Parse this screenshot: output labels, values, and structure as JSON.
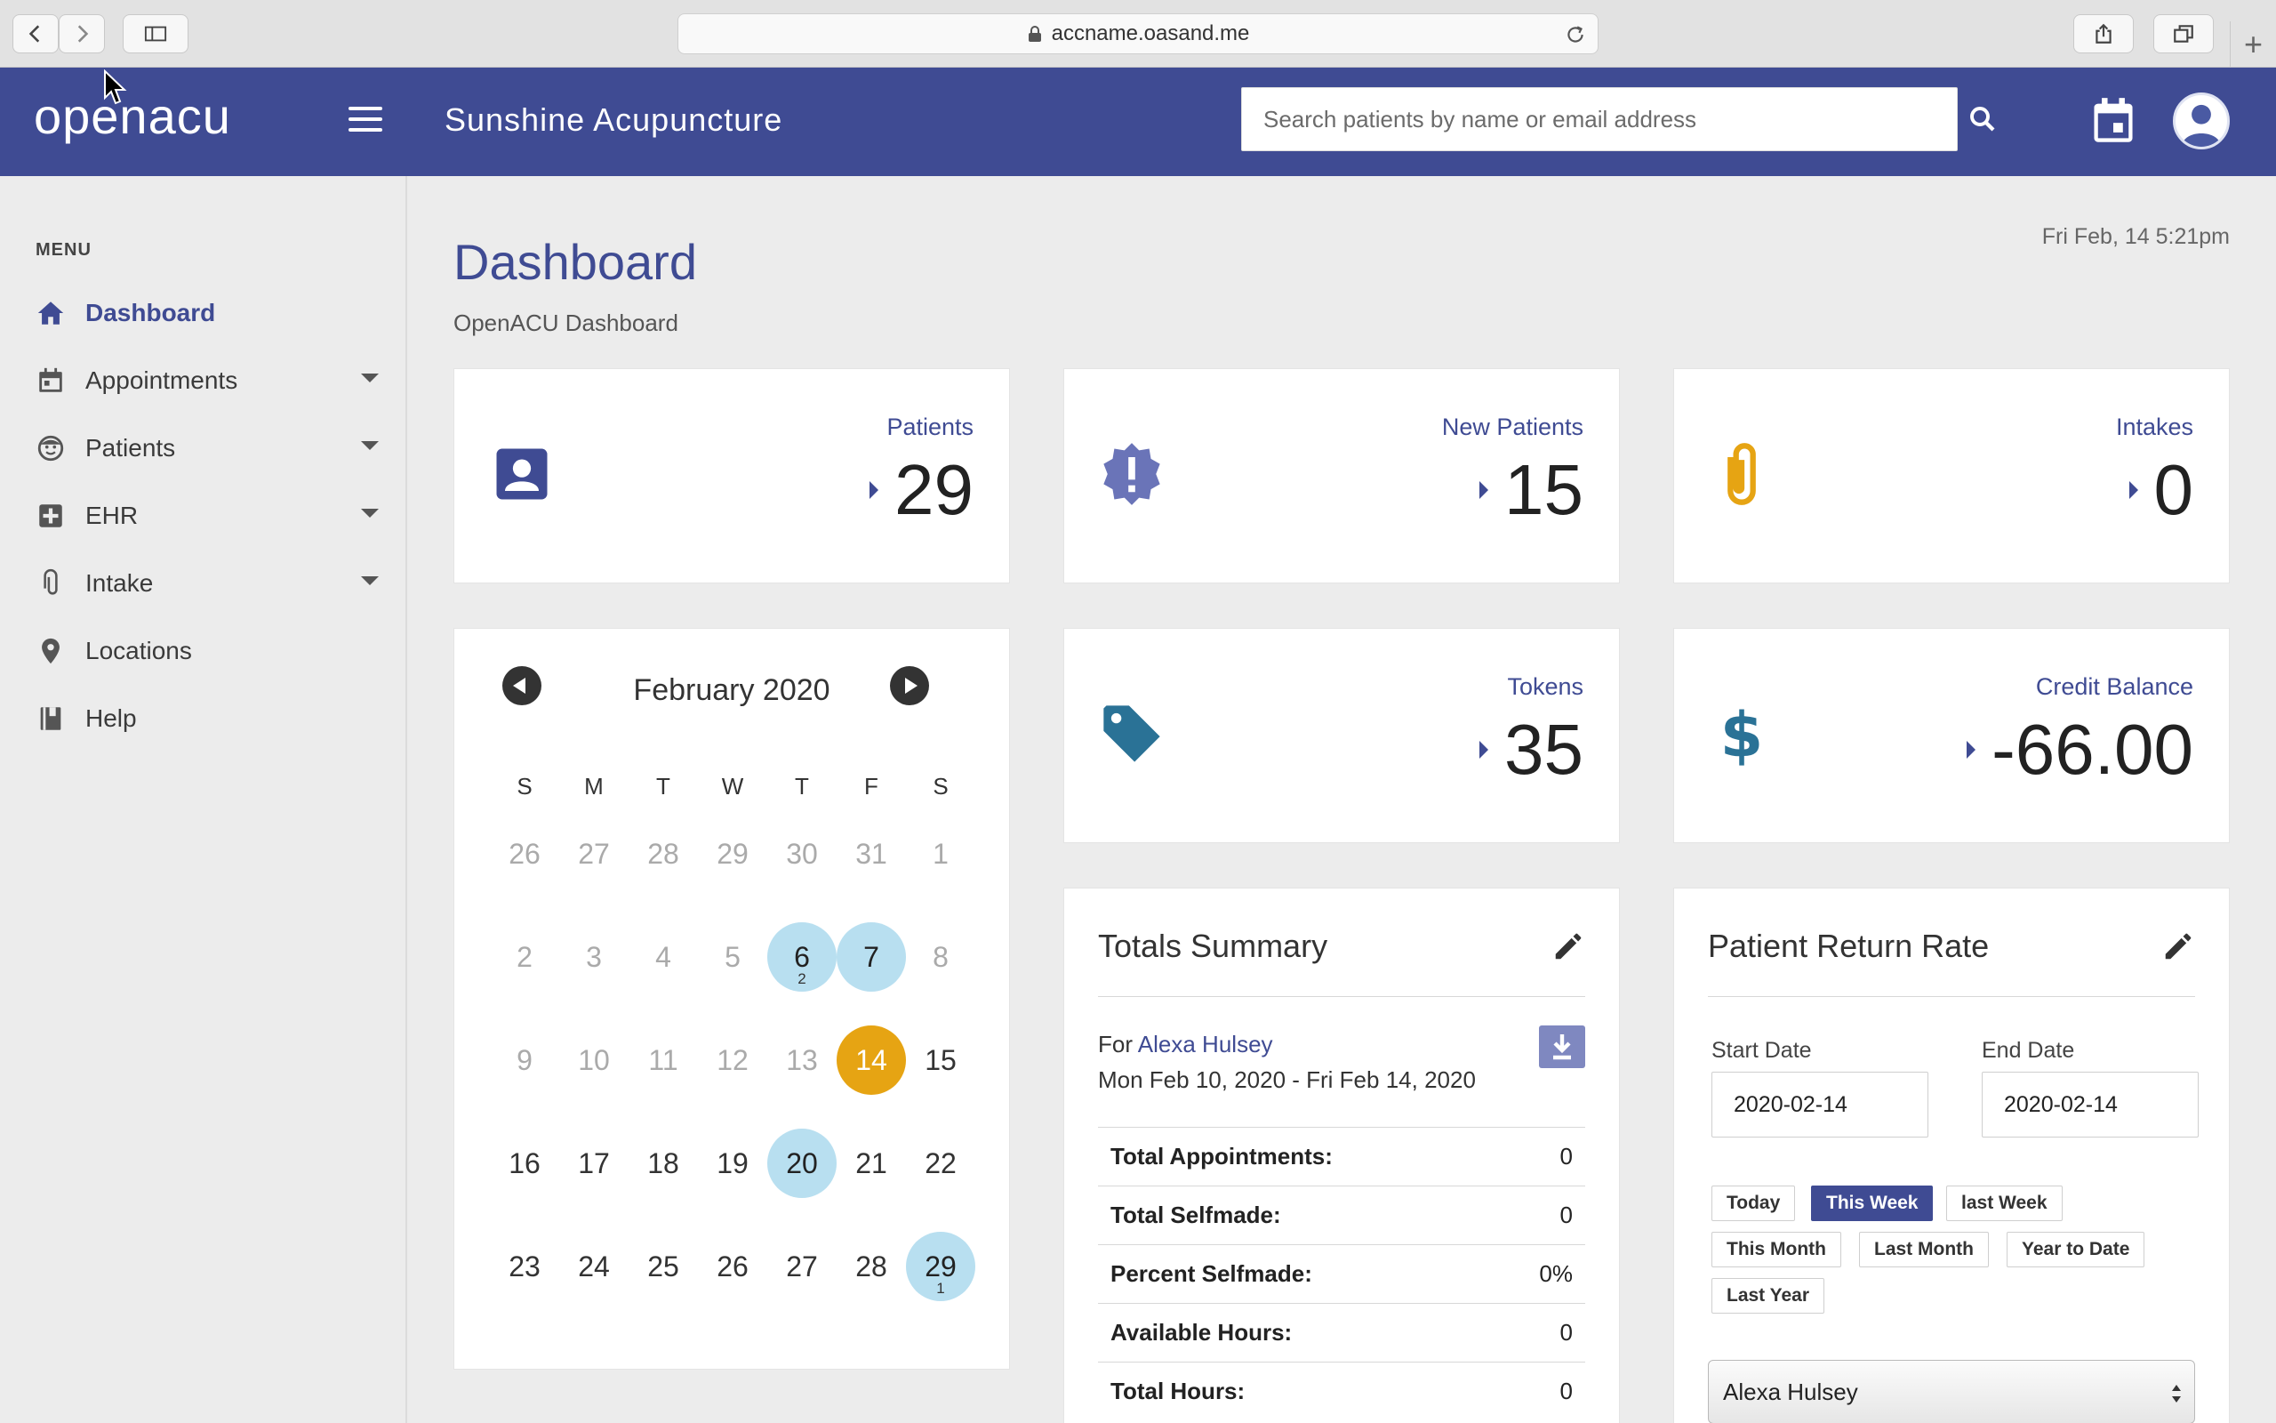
{
  "browser": {
    "url": "accname.oasand.me"
  },
  "header": {
    "logo_text": "openacu",
    "clinic_name": "Sunshine Acupuncture",
    "search_placeholder": "Search patients by name or email address"
  },
  "sidebar": {
    "menu_title": "MENU",
    "items": [
      {
        "label": "Dashboard",
        "icon": "home-icon",
        "active": true,
        "has_submenu": false
      },
      {
        "label": "Appointments",
        "icon": "calendar-icon",
        "active": false,
        "has_submenu": true
      },
      {
        "label": "Patients",
        "icon": "face-icon",
        "active": false,
        "has_submenu": true
      },
      {
        "label": "EHR",
        "icon": "medical-plus-icon",
        "active": false,
        "has_submenu": true
      },
      {
        "label": "Intake",
        "icon": "paperclip-icon",
        "active": false,
        "has_submenu": true
      },
      {
        "label": "Locations",
        "icon": "location-pin-icon",
        "active": false,
        "has_submenu": false
      },
      {
        "label": "Help",
        "icon": "book-icon",
        "active": false,
        "has_submenu": false
      }
    ]
  },
  "page": {
    "title": "Dashboard",
    "subtitle": "OpenACU Dashboard",
    "datetime": "Fri Feb, 14 5:21pm"
  },
  "stats": {
    "patients": {
      "label": "Patients",
      "value": "29",
      "icon": "contact-card-icon",
      "color": "#3f4b93"
    },
    "new_patients": {
      "label": "New Patients",
      "value": "15",
      "icon": "alert-badge-icon",
      "color": "#6a74b8"
    },
    "intakes": {
      "label": "Intakes",
      "value": "0",
      "icon": "paperclip-icon",
      "color": "#e6a413"
    },
    "tokens": {
      "label": "Tokens",
      "value": "35",
      "icon": "tag-icon",
      "color": "#2a7296"
    },
    "credit_balance": {
      "label": "Credit Balance",
      "value": "-66.00",
      "icon": "dollar-icon",
      "color": "#2a7296"
    }
  },
  "calendar": {
    "month_label": "February 2020",
    "weekdays": [
      "S",
      "M",
      "T",
      "W",
      "T",
      "F",
      "S"
    ],
    "weeks": [
      [
        {
          "d": "26",
          "m": true
        },
        {
          "d": "27",
          "m": true
        },
        {
          "d": "28",
          "m": true
        },
        {
          "d": "29",
          "m": true
        },
        {
          "d": "30",
          "m": true
        },
        {
          "d": "31",
          "m": true
        },
        {
          "d": "1",
          "m": true
        }
      ],
      [
        {
          "d": "2",
          "m": true
        },
        {
          "d": "3",
          "m": true
        },
        {
          "d": "4",
          "m": true
        },
        {
          "d": "5",
          "m": true
        },
        {
          "d": "6",
          "hl": true,
          "count": "2"
        },
        {
          "d": "7",
          "hl": true
        },
        {
          "d": "8",
          "m": true
        }
      ],
      [
        {
          "d": "9",
          "m": true
        },
        {
          "d": "10",
          "m": true
        },
        {
          "d": "11",
          "m": true
        },
        {
          "d": "12",
          "m": true
        },
        {
          "d": "13",
          "m": true
        },
        {
          "d": "14",
          "today": true
        },
        {
          "d": "15"
        }
      ],
      [
        {
          "d": "16"
        },
        {
          "d": "17"
        },
        {
          "d": "18"
        },
        {
          "d": "19"
        },
        {
          "d": "20",
          "hl": true
        },
        {
          "d": "21"
        },
        {
          "d": "22"
        }
      ],
      [
        {
          "d": "23"
        },
        {
          "d": "24"
        },
        {
          "d": "25"
        },
        {
          "d": "26"
        },
        {
          "d": "27"
        },
        {
          "d": "28"
        },
        {
          "d": "29",
          "hl": true,
          "count": "1"
        }
      ]
    ]
  },
  "totals": {
    "title": "Totals Summary",
    "for_prefix": "For",
    "practitioner": "Alexa Hulsey",
    "date_range": "Mon Feb 10, 2020 - Fri Feb 14, 2020",
    "rows": [
      {
        "label": "Total Appointments:",
        "value": "0"
      },
      {
        "label": "Total Selfmade:",
        "value": "0"
      },
      {
        "label": "Percent Selfmade:",
        "value": "0%"
      },
      {
        "label": "Available Hours:",
        "value": "0"
      },
      {
        "label": "Total Hours:",
        "value": "0"
      }
    ]
  },
  "return_rate": {
    "title": "Patient Return Rate",
    "start_label": "Start Date",
    "start_value": "2020-02-14",
    "end_label": "End Date",
    "end_value": "2020-02-14",
    "ranges": [
      {
        "label": "Today",
        "active": false
      },
      {
        "label": "This Week",
        "active": true
      },
      {
        "label": "last Week",
        "active": false
      },
      {
        "label": "This Month",
        "active": false
      },
      {
        "label": "Last Month",
        "active": false
      },
      {
        "label": "Year to Date",
        "active": false
      },
      {
        "label": "Last Year",
        "active": false
      }
    ],
    "practitioner_selected": "Alexa Hulsey"
  },
  "colors": {
    "primary": "#3f4b93",
    "accent_gold": "#e6a413",
    "calendar_highlight": "#b8dff0"
  }
}
